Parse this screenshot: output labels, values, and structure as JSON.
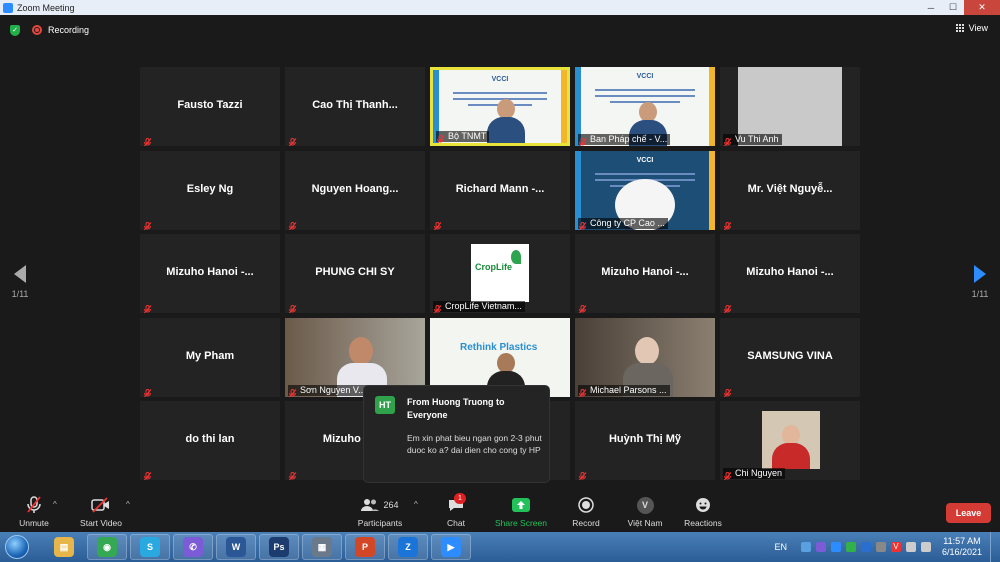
{
  "window": {
    "title": "Zoom Meeting"
  },
  "topbar": {
    "recording_label": "Recording",
    "view_label": "View"
  },
  "nav": {
    "page_left": "1/11",
    "page_right": "1/11"
  },
  "tiles": [
    {
      "name": "Fausto Tazzi",
      "type": "name"
    },
    {
      "name": "Cao Thị Thanh...",
      "type": "name"
    },
    {
      "name": "Bộ TNMT",
      "type": "slide",
      "active": true
    },
    {
      "name": "Ban Pháp chế - V...",
      "type": "slide"
    },
    {
      "name": "Vu Thi Anh",
      "type": "blank"
    },
    {
      "name": "Esley Ng",
      "type": "name"
    },
    {
      "name": "Nguyen Hoang...",
      "type": "name"
    },
    {
      "name": "Richard Mann -...",
      "type": "name"
    },
    {
      "name": "Công ty CP Cao ...",
      "type": "slide2"
    },
    {
      "name": "Mr. Việt Nguyễ...",
      "type": "name"
    },
    {
      "name": "Mizuho Hanoi -...",
      "type": "name"
    },
    {
      "name": "PHUNG CHI SY",
      "type": "name"
    },
    {
      "name": "CropLife Vietnam...",
      "type": "logo"
    },
    {
      "name": "Mizuho Hanoi -...",
      "type": "name"
    },
    {
      "name": "Mizuho Hanoi -...",
      "type": "name"
    },
    {
      "name": "My Pham",
      "type": "name"
    },
    {
      "name": "Sơn Nguyen V...",
      "type": "video"
    },
    {
      "name": "",
      "type": "rethink"
    },
    {
      "name": "Michael Parsons ...",
      "type": "video2"
    },
    {
      "name": "SAMSUNG VINA",
      "type": "name"
    },
    {
      "name": "do thi lan",
      "type": "name"
    },
    {
      "name": "Mizuho Ha...",
      "type": "name"
    },
    {
      "name": "",
      "type": "name"
    },
    {
      "name": "Huỳnh Thị Mỹ",
      "type": "name"
    },
    {
      "name": "Chi Nguyen",
      "type": "photo"
    }
  ],
  "slide_text": {
    "veci": "VCCI",
    "rethink": "Rethink Plastics",
    "logo": "CropLife"
  },
  "chat": {
    "initials": "HT",
    "from": "From Huong Truong to Everyone",
    "message": "Em xin phat bieu ngan gon 2-3 phut duoc ko a? dai dien cho cong ty HP"
  },
  "toolbar": {
    "unmute": "Unmute",
    "start_video": "Start Video",
    "participants": "Participants",
    "participants_count": "264",
    "chat": "Chat",
    "chat_badge": "1",
    "share_screen": "Share Screen",
    "record": "Record",
    "language": "Việt Nam",
    "language_initial": "V",
    "reactions": "Reactions",
    "leave": "Leave"
  },
  "taskbar": {
    "lang": "EN",
    "time": "11:57 AM",
    "date": "6/16/2021",
    "apps": [
      "Explorer",
      "Chrome",
      "Skype",
      "Viber",
      "Word",
      "Photoshop",
      "Calculator",
      "PowerPoint",
      "Zalo",
      "Zoom"
    ]
  }
}
